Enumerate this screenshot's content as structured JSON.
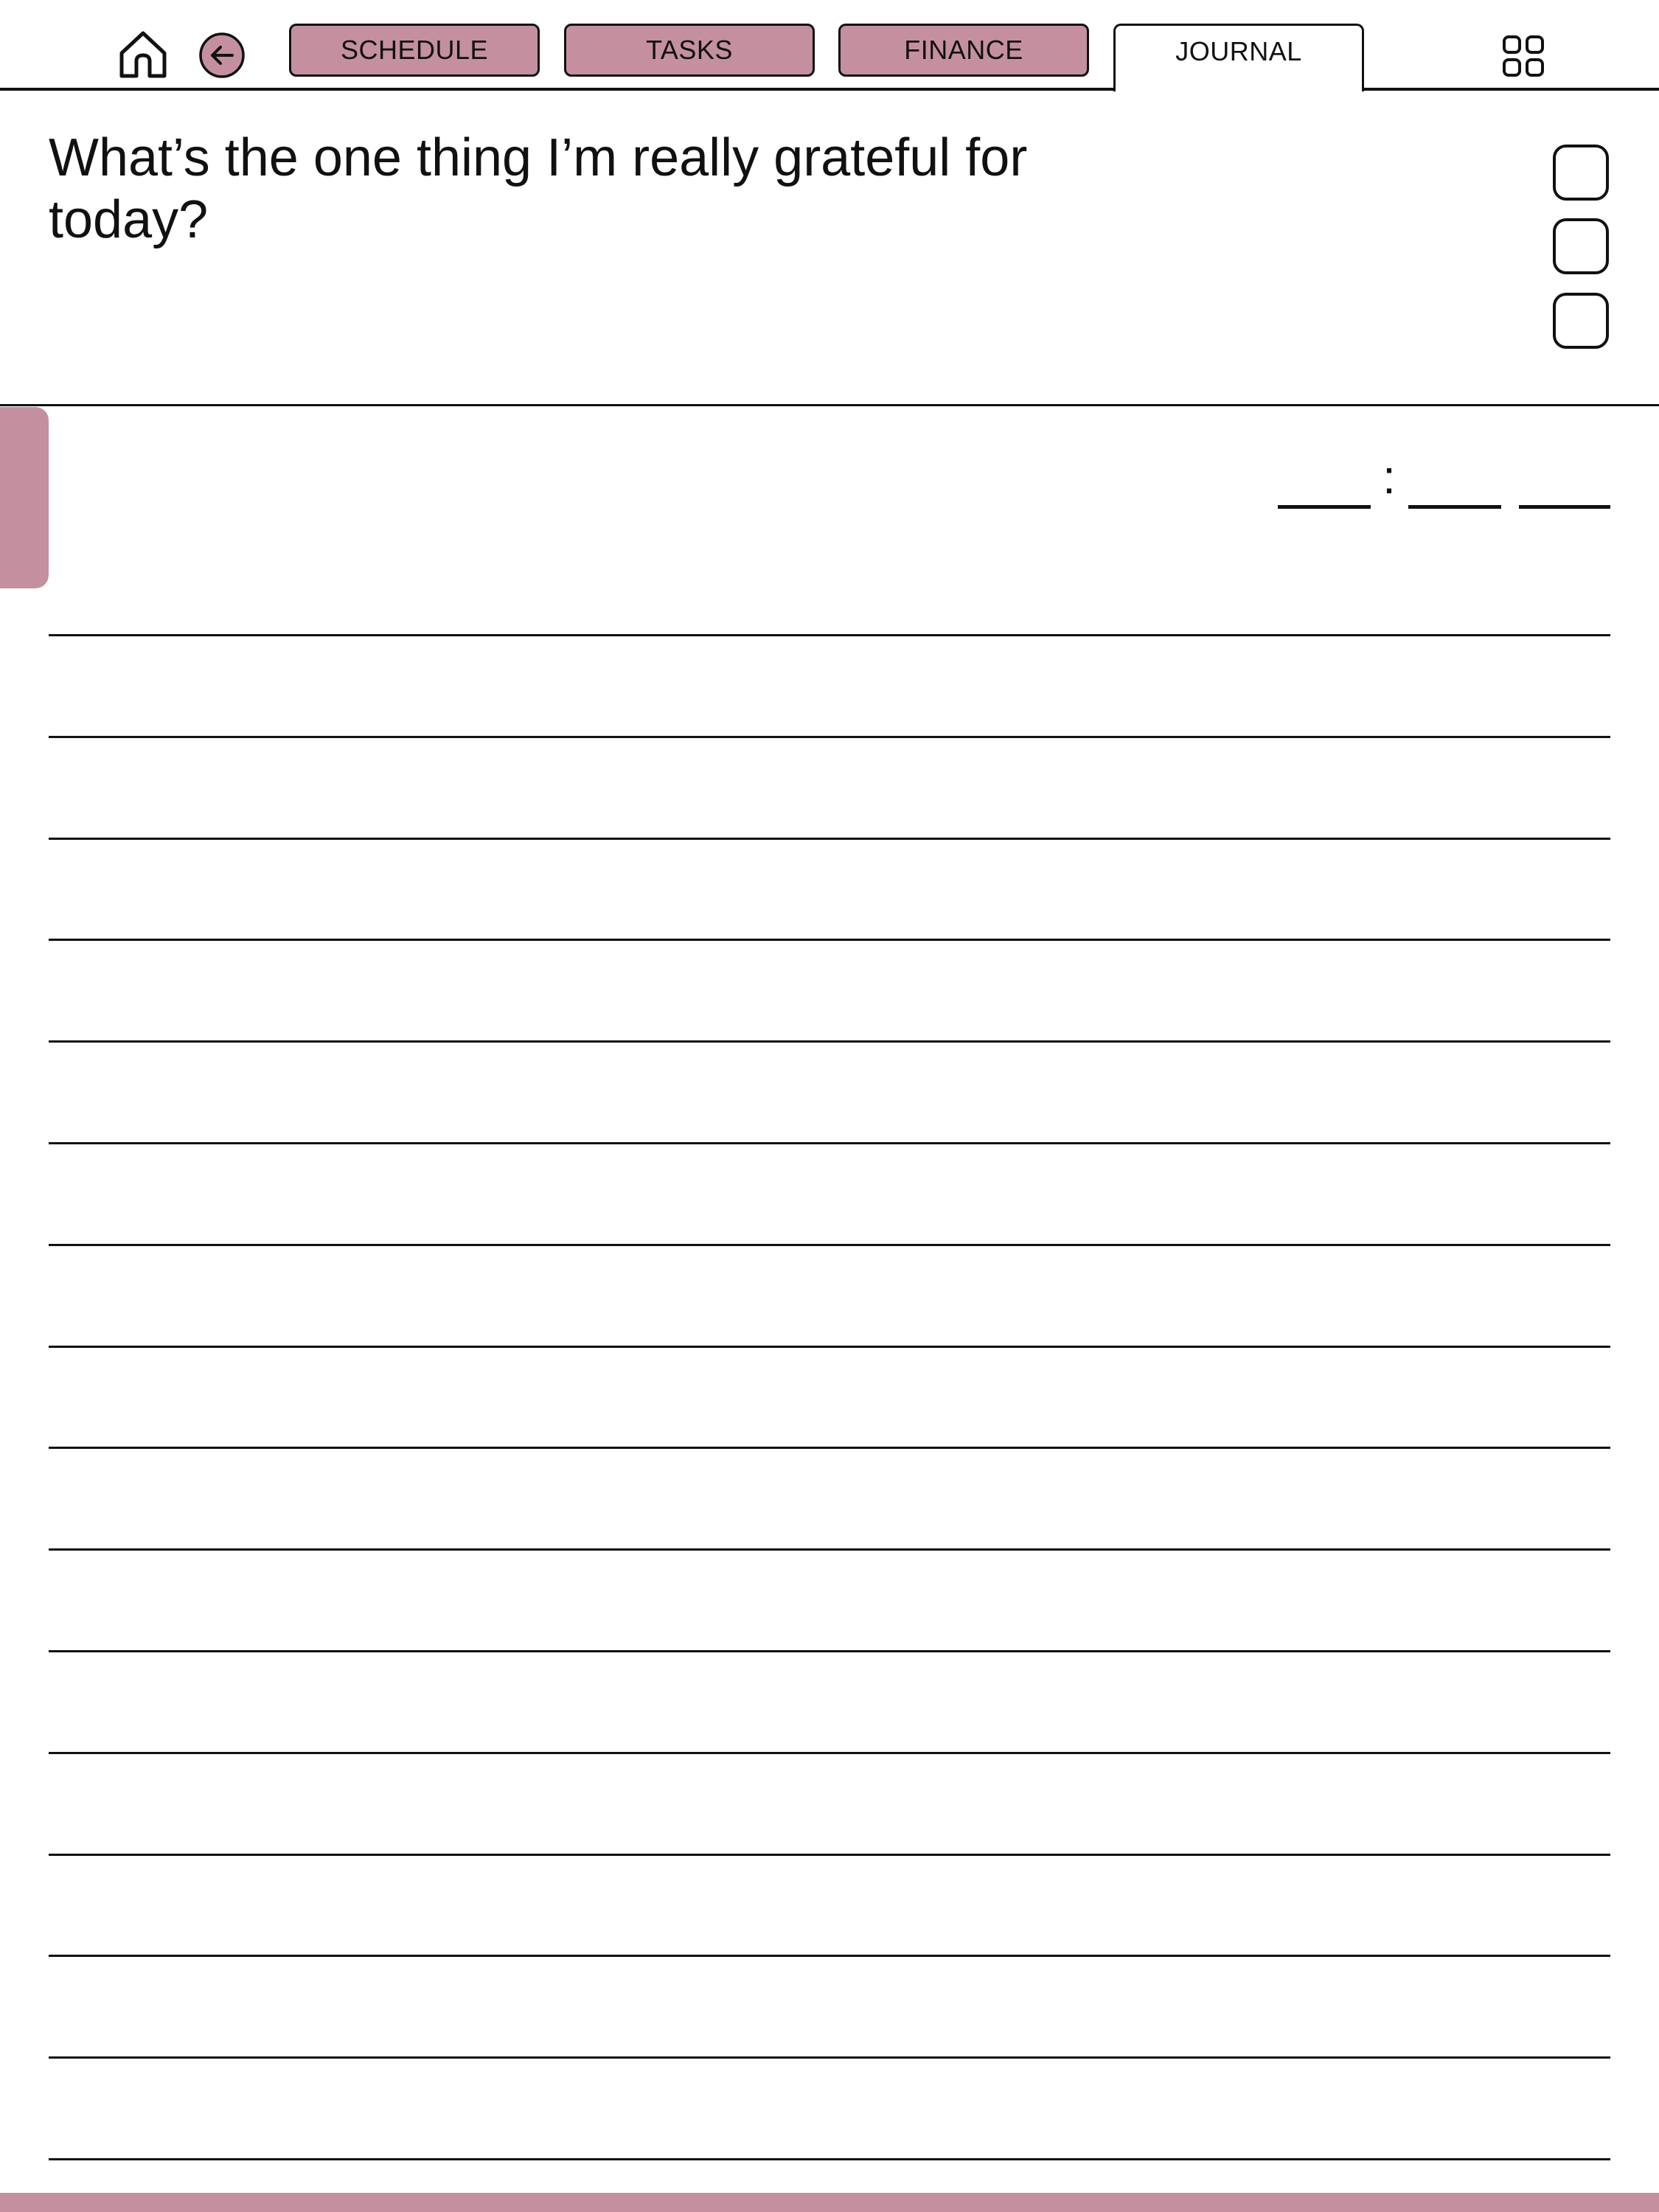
{
  "colors": {
    "accent": "#c4909f",
    "ink": "#111111",
    "paper": "#ffffff"
  },
  "nav": {
    "home_icon": "home-icon",
    "back_icon": "arrow-left-circle-icon",
    "grid_icon": "grid-four-icon",
    "tabs": [
      {
        "label": "SCHEDULE",
        "active": false
      },
      {
        "label": "TASKS",
        "active": false
      },
      {
        "label": "FINANCE",
        "active": false
      },
      {
        "label": "JOURNAL",
        "active": true
      }
    ]
  },
  "prompt": {
    "text": "What’s the one thing I’m really grateful for today?"
  },
  "checkboxes": [
    {
      "checked": false
    },
    {
      "checked": false
    },
    {
      "checked": false
    }
  ],
  "time": {
    "separator": ":",
    "hours": "",
    "minutes": "",
    "period": ""
  },
  "journal": {
    "ruled_line_count": 16,
    "text": ""
  }
}
